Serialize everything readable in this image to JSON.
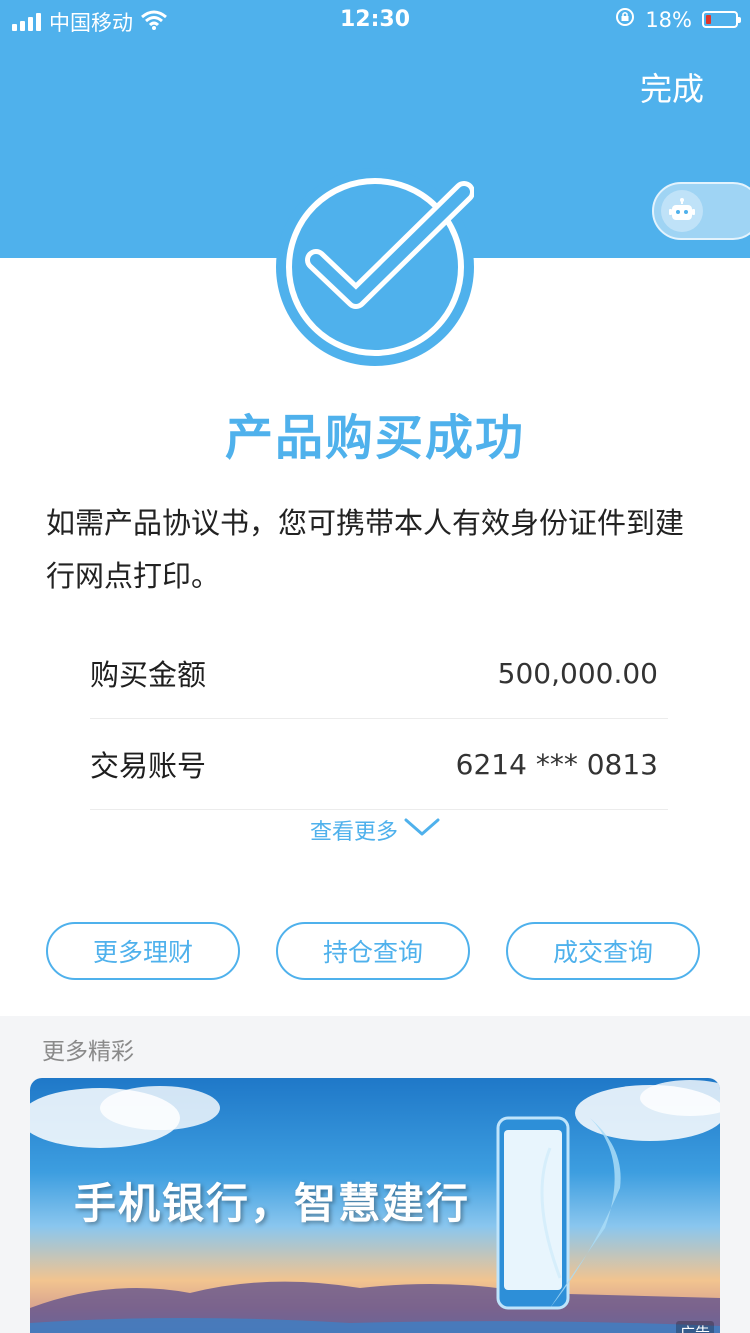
{
  "status_bar": {
    "carrier": "中国移动",
    "time": "12:30",
    "battery_percent": "18%",
    "battery_level": 0.18,
    "signal_icon": "signal-icon",
    "wifi_icon": "wifi-icon",
    "lock_icon": "rotation-lock-icon"
  },
  "header": {
    "done_label": "完成",
    "robot_icon": "robot-icon"
  },
  "result": {
    "title": "产品购买成功",
    "notice": "如需产品协议书，您可携带本人有效身份证件到建行网点打印。"
  },
  "details": [
    {
      "label": "购买金额",
      "value": "500,000.00"
    },
    {
      "label": "交易账号",
      "value": "6214 *** 0813"
    }
  ],
  "see_more": {
    "label": "查看更多",
    "icon": "chevron-down-icon"
  },
  "actions": [
    {
      "label": "更多理财"
    },
    {
      "label": "持仓查询"
    },
    {
      "label": "成交查询"
    }
  ],
  "more_section": {
    "title": "更多精彩",
    "banner_text": "手机银行，智慧建行",
    "ad_label": "广告"
  },
  "colors": {
    "primary": "#4fb1ec",
    "battery_low": "#e0352b"
  }
}
